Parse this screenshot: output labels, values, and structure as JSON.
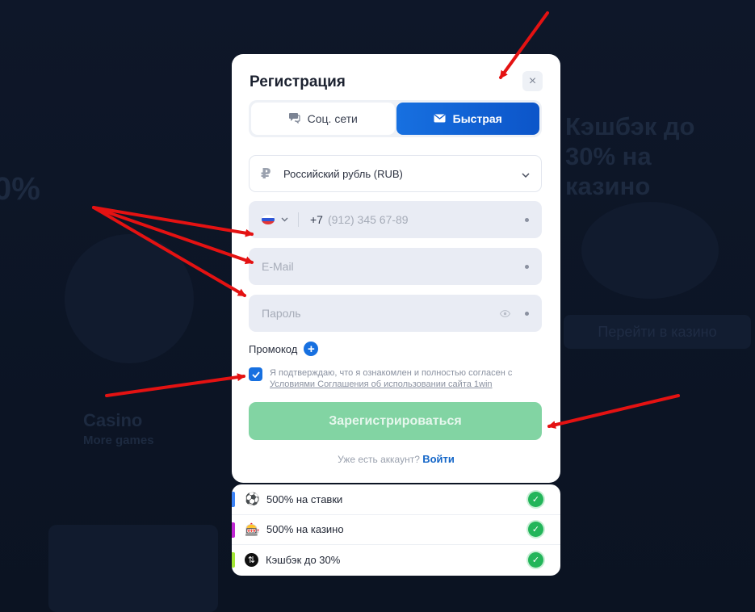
{
  "background": {
    "cashback_text": "Кэшбэк до 30% на казино",
    "percent_text": "0%",
    "casino_text": "Casino",
    "casino_sub": "More games",
    "button_text": "Перейти в казино"
  },
  "modal": {
    "title": "Регистрация",
    "close_icon": "×",
    "tabs": [
      {
        "label": "Соц. сети",
        "icon": "chat-icon",
        "active": false
      },
      {
        "label": "Быстрая",
        "icon": "envelope-icon",
        "active": true
      }
    ],
    "currency": {
      "symbol": "₽",
      "value": "Российский рубль (RUB)"
    },
    "phone": {
      "prefix": "+7",
      "placeholder": "(912) 345 67-89",
      "country_flag": "ru-flag-icon"
    },
    "email": {
      "placeholder": "E-Mail"
    },
    "password": {
      "placeholder": "Пароль"
    },
    "promo": {
      "label": "Промокод",
      "add_icon": "+"
    },
    "agreement": {
      "checked": true,
      "text": "Я подтверждаю, что я ознакомлен и полностью согласен с",
      "link": "Условиями Соглашения об использовании сайта 1win"
    },
    "register_button": "Зарегистрироваться",
    "login_prompt": "Уже есть аккаунт?",
    "login_link": "Войти"
  },
  "bonuses": [
    {
      "label": "500% на ставки",
      "icon": "⚽",
      "bar_color": "#3b82f6"
    },
    {
      "label": "500% на казино",
      "icon": "🎰",
      "bar_color": "#c026d3"
    },
    {
      "label": "Кэшбэк до 30%",
      "icon": "⇅",
      "bar_color": "#a3e635"
    }
  ],
  "colors": {
    "accent": "#1770e0",
    "success": "#23b55a",
    "register_button": "#82d4a3",
    "annotation_arrow": "#e41212"
  }
}
